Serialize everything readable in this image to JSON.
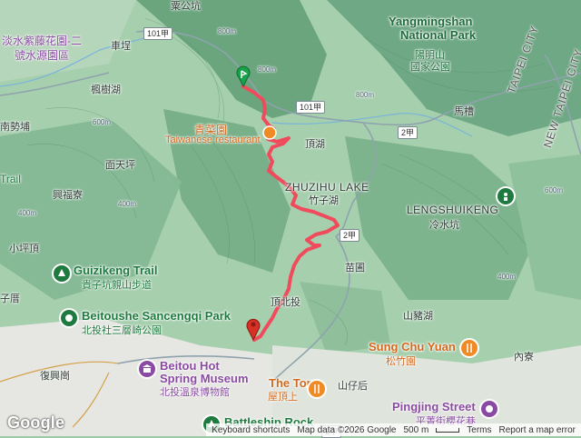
{
  "labels": {
    "tamsui_wisteria": "淡水紫藤花園-二",
    "tamsui_wisteria_2": "號水源園區",
    "chepu": "車埕",
    "fengshuhu": "楓樹湖",
    "nanshipu": "南勢埔",
    "trail_left": "Trail",
    "qingcaiyuan_cn": "青菜園",
    "qingcaiyuan_en": "Taiwanese restaurant",
    "miantianping": "面天坪",
    "xingfuliao": "興福寮",
    "xiaopingding": "小坪頂",
    "guizikeng_en": "Guizikeng Trail",
    "guizikeng_cn": "貴子坑親山步道",
    "beitoushe_en": "Beitoushe Sancengqi Park",
    "beitoushe_cn": "北投社三層崎公園",
    "zilicuo": "子厝",
    "fuxinggang": "復興崗",
    "hotspring_en": "Beitou Hot",
    "hotspring_en2": "Spring Museum",
    "hotspring_cn": "北投溫泉博物館",
    "battleship": "Battleship Rock",
    "yangmingshan_en": "Yangmingshan",
    "yangmingshan_en2": "National Park",
    "yangmingshan_cn": "陽明山",
    "yangmingshan_cn2": "國家公園",
    "macao": "馬槽",
    "dinghu": "頂湖",
    "zhuzihu_en": "ZHUZIHU LAKE",
    "zhuzihu_cn": "竹子湖",
    "lengshuikeng_en": "LENGSHUIKENG",
    "lengshuikeng_cn": "冷水坑",
    "miaopu": "苗圃",
    "dingbeitou": "頂北投",
    "shanzhuhu": "山豬湖",
    "sungchuyuan_en": "Sung Chu Yuan",
    "sungchuyuan_cn": "松竹園",
    "neiliao": "內寮",
    "thetop_en": "The Top",
    "thetop_cn": "屋頂上",
    "shanzaihou": "山仔后",
    "pingjing_en": "Pingjing Street",
    "pingjing_cn": "平菁街櫻花巷",
    "taipei_city": "TAIPEI CITY",
    "new_taipei_city": "NEW TAIPEI CITY",
    "top_road": "粟公坑"
  },
  "shields": {
    "r101_top": "101甲",
    "r101_mid": "101甲",
    "r2jia_mid": "2甲",
    "r2jia_low": "2甲",
    "r2jia_bottom": "2甲"
  },
  "attribution": {
    "logo": "Google",
    "shortcuts": "Keyboard shortcuts",
    "mapdata": "Map data ©2026 Google",
    "scale": "500 m",
    "terms": "Terms",
    "report": "Report a map error"
  },
  "contours": [
    "800m",
    "400m",
    "600m",
    "600m",
    "800m",
    "400m",
    "400m",
    "800m"
  ],
  "colors": {
    "route": "#f04b5c",
    "start_marker": "#1aa24a",
    "end_marker": "#d93025"
  }
}
